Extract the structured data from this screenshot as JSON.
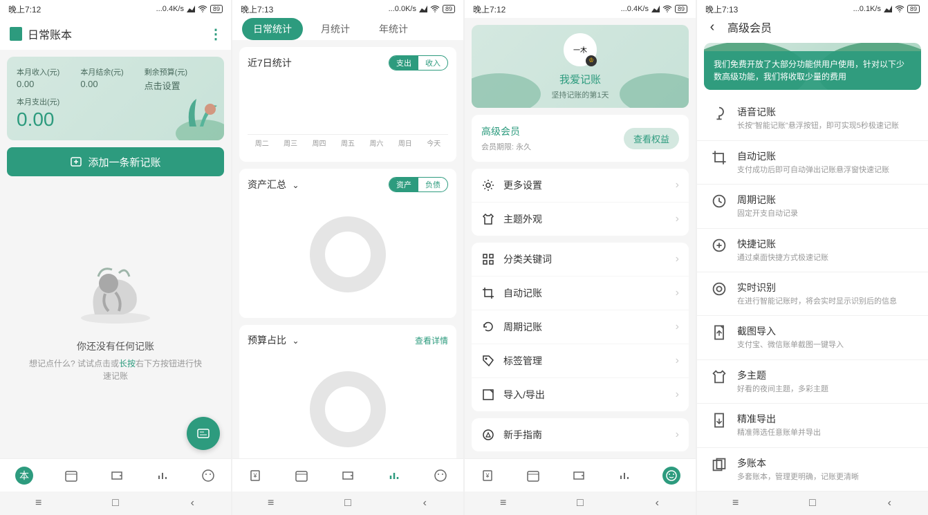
{
  "status": {
    "time_a": "晚上7:12",
    "time_b": "晚上7:13",
    "net_a": "...0.4K/s",
    "net_b": "...0.0K/s",
    "net_c": "...0.1K/s",
    "battery": "89"
  },
  "screen1": {
    "title": "日常账本",
    "income_label": "本月收入(元)",
    "income_val": "0.00",
    "balance_label": "本月结余(元)",
    "balance_val": "0.00",
    "budget_label": "剩余预算(元)",
    "budget_val": "点击设置",
    "expense_label": "本月支出(元)",
    "expense_val": "0.00",
    "add_btn": "添加一条新记账",
    "empty_title": "你还没有任何记账",
    "empty_sub_1": "想记点什么? 试试点击或",
    "empty_link": "长按",
    "empty_sub_2": "右下方按钮进行快速记账"
  },
  "screen2": {
    "tabs": [
      "日常统计",
      "月统计",
      "年统计"
    ],
    "card1_title": "近7日统计",
    "pill_expense": "支出",
    "pill_income": "收入",
    "axis": [
      "周二",
      "周三",
      "周四",
      "周五",
      "周六",
      "周日",
      "今天"
    ],
    "card2_title": "资产汇总",
    "pill_asset": "资产",
    "pill_debt": "负债",
    "card3_title": "预算占比",
    "detail_link": "查看详情"
  },
  "screen3": {
    "avatar_text": "一木",
    "username": "我爱记账",
    "subtitle": "坚持记账的第1天",
    "vip_title": "高级会员",
    "vip_sub": "会员期限: 永久",
    "vip_btn": "查看权益",
    "group1": [
      "更多设置",
      "主题外观"
    ],
    "group2": [
      "分类关键词",
      "自动记账",
      "周期记账",
      "标签管理",
      "导入/导出"
    ],
    "group3": [
      "新手指南"
    ]
  },
  "screen4": {
    "title": "高级会员",
    "banner_text": "我们免费开放了大部分功能供用户使用，针对以下少数高级功能，我们将收取少量的费用",
    "features": [
      {
        "title": "语音记账",
        "desc": "长按\"智能记账\"悬浮按钮，即可实现5秒极速记账"
      },
      {
        "title": "自动记账",
        "desc": "支付成功后即可自动弹出记账悬浮窗快速记账"
      },
      {
        "title": "周期记账",
        "desc": "固定开支自动记录"
      },
      {
        "title": "快捷记账",
        "desc": "通过桌面快捷方式极速记账"
      },
      {
        "title": "实时识别",
        "desc": "在进行智能记账时，将会实时显示识别后的信息"
      },
      {
        "title": "截图导入",
        "desc": "支付宝、微信账单截图一键导入"
      },
      {
        "title": "多主题",
        "desc": "好看的夜间主题，多彩主题"
      },
      {
        "title": "精准导出",
        "desc": "精准筛选任意账单并导出"
      },
      {
        "title": "多账本",
        "desc": "多套账本，管理更明确，记账更清晰"
      }
    ]
  }
}
